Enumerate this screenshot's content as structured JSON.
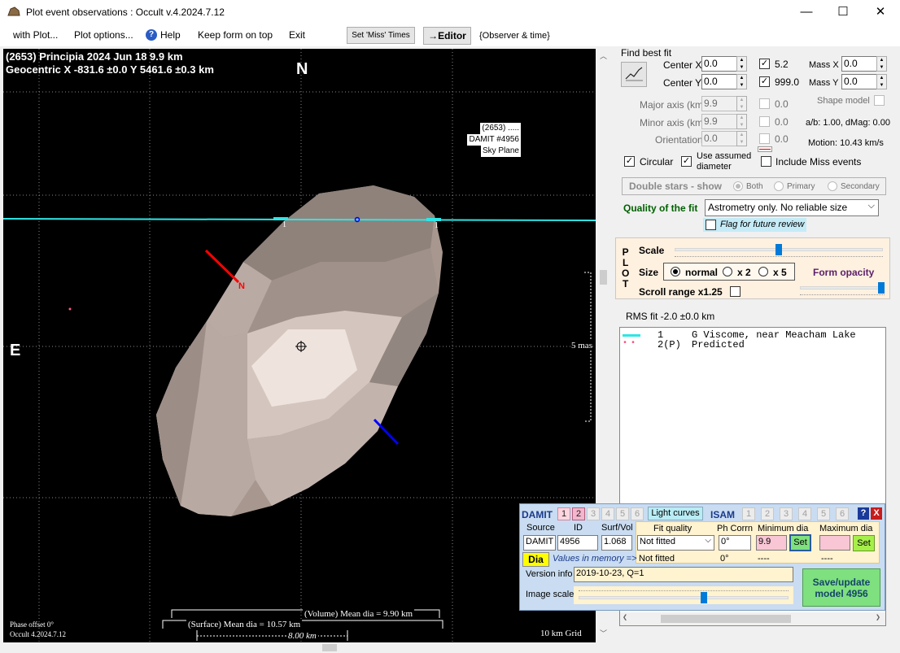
{
  "window": {
    "title": "Plot event observations : Occult v.4.2024.7.12",
    "minimize": "—",
    "maximize": "☐",
    "close": "✕"
  },
  "menu": {
    "with_plot": "with Plot...",
    "plot_options": "Plot options...",
    "help": "Help",
    "keep_on_top": "Keep form on top",
    "exit": "Exit",
    "set_miss_times": "Set 'Miss' Times",
    "editor": "→Editor",
    "observer_time": "{Observer & time}"
  },
  "plot": {
    "header_line1": "(2653) Principia  2024 Jun 18  9.9 km",
    "header_line2": "Geocentric X  -831.6 ±0.0  Y 5461.6 ±0.3 km",
    "north": "N",
    "east": "E",
    "pole_label": "N",
    "chord_label_left": "1",
    "chord_label_right": "1",
    "shape_info_1": "(2653) .....",
    "shape_info_2": "DAMIT #4956",
    "shape_info_3": "Sky Plane",
    "scale_mas": "5 mas",
    "phase_offset": "Phase offset 0°",
    "occult_version": "Occult 4.2024.7.12",
    "volume_dia": "(Volume) Mean dia = 9.90 km",
    "surface_dia": "(Surface) Mean dia = 10.57 km",
    "scale_km": "8.00 km",
    "grid": "10 km Grid",
    "colors": {
      "chord": "#2ee6e6",
      "pole_north": "#ff0000",
      "pole_south": "#0000ff",
      "background": "#000000"
    }
  },
  "fit": {
    "find_best_fit": "Find best fit",
    "center_x_label": "Center X",
    "center_x": "0.0",
    "center_y_label": "Center Y",
    "center_y": "0.0",
    "cx_weight": "5.2",
    "cy_weight": "999.0",
    "mass_x_label": "Mass X",
    "mass_x": "0.0",
    "mass_y_label": "Mass Y",
    "mass_y": "0.0",
    "shape_model": "Shape model",
    "major_label": "Major axis (km)",
    "major": "9.9",
    "major_w": "0.0",
    "minor_label": "Minor axis (km)",
    "minor": "9.9",
    "minor_w": "0.0",
    "orient_label": "Orientation",
    "orient": "0.0",
    "orient_w": "0.0",
    "ab_dmag": "a/b: 1.00, dMag: 0.00",
    "motion": "Motion: 10.43 km/s",
    "circular": "Circular",
    "use_assumed_1": "Use assumed",
    "use_assumed_2": "diameter",
    "include_miss": "Include Miss events",
    "double_stars": "Double stars - show",
    "both": "Both",
    "primary": "Primary",
    "secondary": "Secondary",
    "quality_label": "Quality of the fit",
    "quality_value": "Astrometry only. No reliable size",
    "flag_review": "Flag for future review"
  },
  "plotctl": {
    "p": "P",
    "l": "L",
    "o": "O",
    "t": "T",
    "scale": "Scale",
    "size": "Size",
    "normal": "normal",
    "x2": "x 2",
    "x5": "x 5",
    "form_opacity": "Form opacity",
    "scroll_range": "Scroll range x1.25",
    "scale_level": 0.5,
    "opacity_level": 1.0
  },
  "rms": "RMS fit -2.0 ±0.0 km",
  "legend": [
    {
      "num": "1",
      "text": "G Viscome, near Meacham Lake"
    },
    {
      "num": "2(P)",
      "text": "Predicted"
    }
  ],
  "damit": {
    "title": "DAMIT",
    "nums": [
      "1",
      "2",
      "3",
      "4",
      "5",
      "6"
    ],
    "light_curves": "Light curves",
    "isam": "ISAM",
    "help": "?",
    "close": "X",
    "source_label": "Source",
    "id_label": "ID",
    "surf_label": "Surf/Vol",
    "fit_quality_label": "Fit quality",
    "ph_corr_label": "Ph Corrn",
    "min_dia_label": "Minimum dia",
    "max_dia_label": "Maximum dia",
    "source": "DAMIT",
    "id": "4956",
    "surf": "1.068",
    "fit_quality": "Not fitted",
    "ph_corr": "0°",
    "min_dia": "9.9",
    "set": "Set",
    "dia": "Dia",
    "values_memory": "Values in memory =>",
    "mem_fit": "Not fitted",
    "mem_ph": "0°",
    "mem_min": "----",
    "mem_max": "----",
    "version_label": "Version info",
    "version": "2019-10-23, Q=1",
    "image_scale": "Image scale",
    "image_scale_level": 0.6,
    "save_1": "Save/update",
    "save_2": "model 4956"
  }
}
